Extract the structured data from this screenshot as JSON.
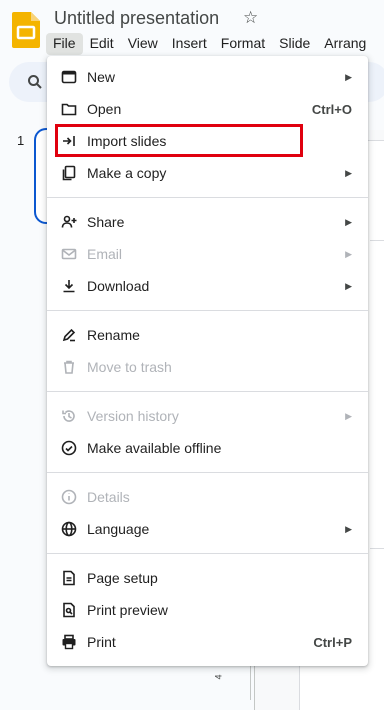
{
  "app": {
    "title": "Untitled presentation",
    "star_icon": "star-icon",
    "logo_icon": "slides-logo-icon"
  },
  "menubar": [
    "File",
    "Edit",
    "View",
    "Insert",
    "Format",
    "Slide",
    "Arrang"
  ],
  "workspace": {
    "slide_number": "1",
    "ruler_mark": "4"
  },
  "file_menu": {
    "groups": [
      [
        {
          "label": "New",
          "icon": "new-presentation-icon",
          "submenu": true,
          "disabled": false
        },
        {
          "label": "Open",
          "icon": "folder-icon",
          "shortcut": "Ctrl+O",
          "disabled": false
        },
        {
          "label": "Import slides",
          "icon": "import-icon",
          "disabled": false,
          "highlighted": true
        },
        {
          "label": "Make a copy",
          "icon": "copy-icon",
          "submenu": true,
          "disabled": false
        }
      ],
      [
        {
          "label": "Share",
          "icon": "share-person-icon",
          "submenu": true,
          "disabled": false
        },
        {
          "label": "Email",
          "icon": "email-icon",
          "submenu": true,
          "disabled": true
        },
        {
          "label": "Download",
          "icon": "download-icon",
          "submenu": true,
          "disabled": false
        }
      ],
      [
        {
          "label": "Rename",
          "icon": "rename-pencil-icon",
          "disabled": false
        },
        {
          "label": "Move to trash",
          "icon": "trash-icon",
          "disabled": true
        }
      ],
      [
        {
          "label": "Version history",
          "icon": "history-icon",
          "submenu": true,
          "disabled": true
        },
        {
          "label": "Make available offline",
          "icon": "offline-check-icon",
          "disabled": false
        }
      ],
      [
        {
          "label": "Details",
          "icon": "info-icon",
          "disabled": true
        },
        {
          "label": "Language",
          "icon": "globe-icon",
          "submenu": true,
          "disabled": false
        }
      ],
      [
        {
          "label": "Page setup",
          "icon": "page-setup-icon",
          "disabled": false
        },
        {
          "label": "Print preview",
          "icon": "print-preview-icon",
          "disabled": false
        },
        {
          "label": "Print",
          "icon": "print-icon",
          "shortcut": "Ctrl+P",
          "disabled": false
        }
      ]
    ]
  },
  "colors": {
    "highlight_border": "#e0000e",
    "accent_blue": "#0b57d0",
    "logo_yellow": "#f4b400",
    "disabled_text": "#b0b3b8"
  }
}
